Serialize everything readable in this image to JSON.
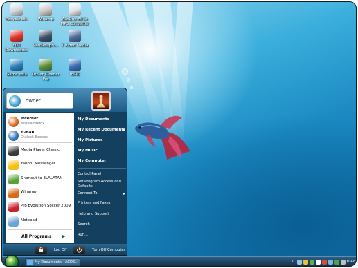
{
  "desktop": {
    "icons": [
      {
        "label": "Recycle Bin",
        "icon": "recycle-bin-icon",
        "color": "#cfd8de"
      },
      {
        "label": "Winamp",
        "icon": "winamp-icon",
        "color": "#c9c9c9"
      },
      {
        "label": "AlwOne All to MP3 Converter",
        "icon": "converter-icon",
        "color": "#e0e4e8"
      },
      {
        "label": "FDX Downloader",
        "icon": "fdx-icon",
        "color": "#e2312a"
      },
      {
        "label": "WinSetupFr...",
        "icon": "setup-icon",
        "color": "#3c4f66"
      },
      {
        "label": "7 Video Media",
        "icon": "video-icon",
        "color": "#4e6d9e"
      },
      {
        "label": "Game sofa",
        "icon": "game-icon",
        "color": "#2c7fba"
      },
      {
        "label": "Driver Cleaner Pro",
        "icon": "driver-cleaner-icon",
        "color": "#5b8f3a"
      },
      {
        "label": "mIRC",
        "icon": "mirc-icon",
        "color": "#3a6fb6"
      }
    ]
  },
  "start_menu": {
    "user_name": "owner",
    "pinned": [
      {
        "name": "Internet",
        "sub": "Mozilla Firefox",
        "icon": "firefox-icon",
        "color": "#e66a1a"
      },
      {
        "name": "E-mail",
        "sub": "Outlook Express",
        "icon": "email-icon",
        "color": "#2d78c4"
      }
    ],
    "programs": [
      {
        "name": "Media Player Classic",
        "icon": "media-player-icon",
        "color": "#3a3a3a"
      },
      {
        "name": "Yahoo! Messenger",
        "icon": "yahoo-messenger-icon",
        "color": "#f3c013"
      },
      {
        "name": "Shortcut to 3LALATAN",
        "icon": "shortcut-icon",
        "color": "#58a339"
      },
      {
        "name": "Winamp",
        "icon": "winamp-icon",
        "color": "#d66a16"
      },
      {
        "name": "Pro Evolution Soccer 2009",
        "icon": "pes-icon",
        "color": "#c8232c"
      },
      {
        "name": "Notepad",
        "icon": "notepad-icon",
        "color": "#6ba5d8"
      }
    ],
    "all_programs": "All Programs",
    "places": [
      {
        "label": "My Documents",
        "bold": true,
        "submenu": false
      },
      {
        "label": "My Recent Documents",
        "bold": true,
        "submenu": true
      },
      {
        "label": "My Pictures",
        "bold": true,
        "submenu": false
      },
      {
        "label": "My Music",
        "bold": true,
        "submenu": false
      },
      {
        "label": "My Computer",
        "bold": true,
        "submenu": false
      }
    ],
    "system_places": [
      {
        "label": "Control Panel",
        "submenu": false
      },
      {
        "label": "Set Program Access and Defaults",
        "submenu": false
      },
      {
        "label": "Connect To",
        "submenu": true
      },
      {
        "label": "Printers and Faxes",
        "submenu": false
      },
      {
        "label": "Help and Support",
        "submenu": false
      },
      {
        "label": "Search",
        "submenu": false
      },
      {
        "label": "Run...",
        "submenu": false
      }
    ],
    "log_off": "Log Off",
    "turn_off": "Turn Off Computer"
  },
  "taskbar": {
    "task_label": "My Documents - ACDS...",
    "clock": "0:48",
    "tray_colors": [
      "#8fc3e8",
      "#f0c030",
      "#5fae4a",
      "#ffffff",
      "#d05030",
      "#7ab8e0",
      "#50a050",
      "#c0c0c0"
    ]
  }
}
